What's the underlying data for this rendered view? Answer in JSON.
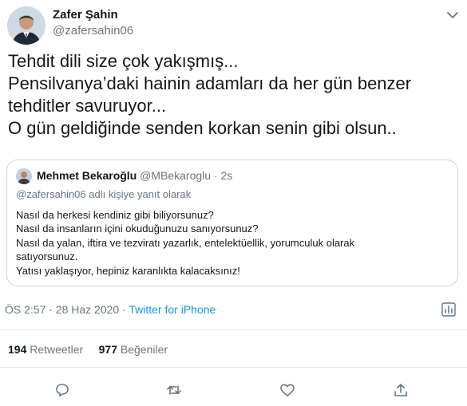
{
  "author": {
    "name": "Zafer Şahin",
    "handle": "@zafersahin06"
  },
  "tweet": {
    "lines": [
      "Tehdit dili size çok yakışmış...",
      "Pensilvanya’daki hainin adamları da her gün benzer",
      "tehditler savuruyor...",
      "O gün geldiğinde senden korkan senin gibi olsun.."
    ]
  },
  "quoted": {
    "name": "Mehmet Bekaroğlu",
    "handle": "@MBekaroglu",
    "separator": "·",
    "age": "2s",
    "reply_note": "@zafersahin06 adlı kişiye yanıt olarak",
    "lines": [
      "Nasıl da herkesi kendiniz gibi biliyorsunuz?",
      "Nasıl da insanların içini okuduğunuzu sanıyorsunuz?",
      "Nasıl da yalan, iftira ve tezviratı yazarlık, entelektüellik, yorumculuk olarak",
      "satıyorsunuz.",
      "Yatısı yaklaşıyor, hepiniz karanlıkta kalacaksınız!"
    ]
  },
  "meta": {
    "time": "ÖS 2:57 · 28 Haz 2020 · ",
    "source": "Twitter for iPhone"
  },
  "stats": {
    "retweets_count": "194",
    "retweets_label": "Retweetler",
    "likes_count": "977",
    "likes_label": "Beğeniler"
  },
  "icons": [
    "chevron-down-icon",
    "analytics-icon",
    "reply-icon",
    "retweet-icon",
    "like-icon",
    "share-icon"
  ],
  "colors": {
    "text": "#14171a",
    "secondary": "#657786",
    "link": "#1b95e0",
    "border": "#ccd6dd"
  }
}
